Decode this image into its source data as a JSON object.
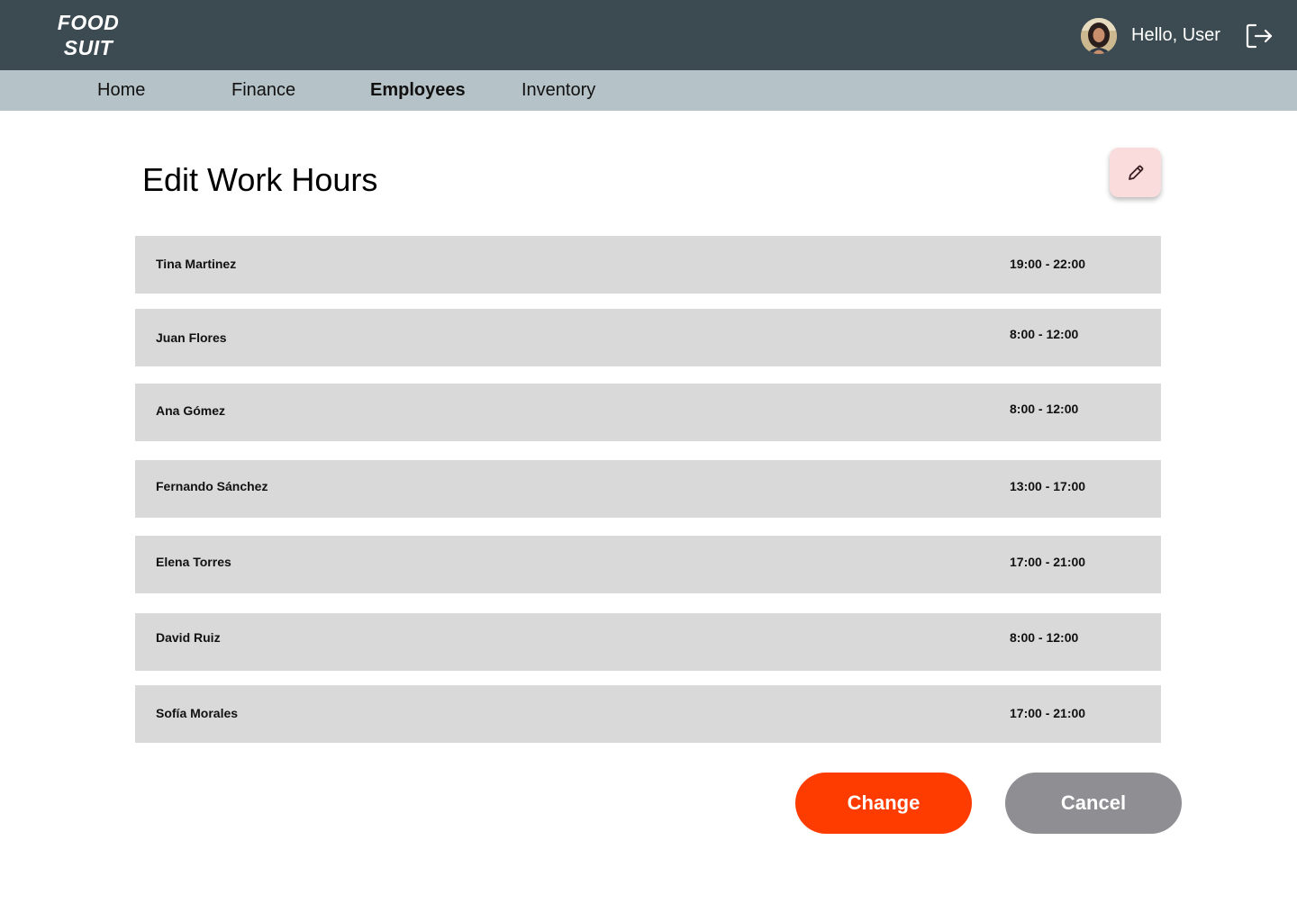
{
  "app": {
    "logo_line1": "FOOD",
    "logo_line2": "SUIT",
    "greeting": "Hello, User"
  },
  "nav": {
    "items": [
      {
        "label": "Home"
      },
      {
        "label": "Finance"
      },
      {
        "label": "Employees"
      },
      {
        "label": "Inventory"
      }
    ],
    "active": "Employees"
  },
  "main": {
    "title": "Edit Work Hours",
    "rows": [
      {
        "name": "Tina Martinez",
        "hours": "19:00 - 22:00"
      },
      {
        "name": "Juan Flores",
        "hours": "8:00 - 12:00"
      },
      {
        "name": "Ana Gómez",
        "hours": "8:00 - 12:00"
      },
      {
        "name": "Fernando Sánchez",
        "hours": "13:00 - 17:00"
      },
      {
        "name": "Elena Torres",
        "hours": "17:00 - 21:00"
      },
      {
        "name": "David Ruiz",
        "hours": "8:00 - 12:00"
      },
      {
        "name": "Sofía Morales",
        "hours": "17:00 - 21:00"
      }
    ]
  },
  "actions": {
    "change_label": "Change",
    "cancel_label": "Cancel"
  },
  "icons": {
    "edit": "pencil-icon",
    "logout": "logout-icon",
    "avatar": "user-avatar"
  },
  "colors": {
    "topbar": "#3c4b52",
    "navbar": "#b5c2c7",
    "row": "#d9d9d9",
    "change": "#ff3c00",
    "cancel": "#8f8f93",
    "edit_button": "#f9dcdb"
  }
}
